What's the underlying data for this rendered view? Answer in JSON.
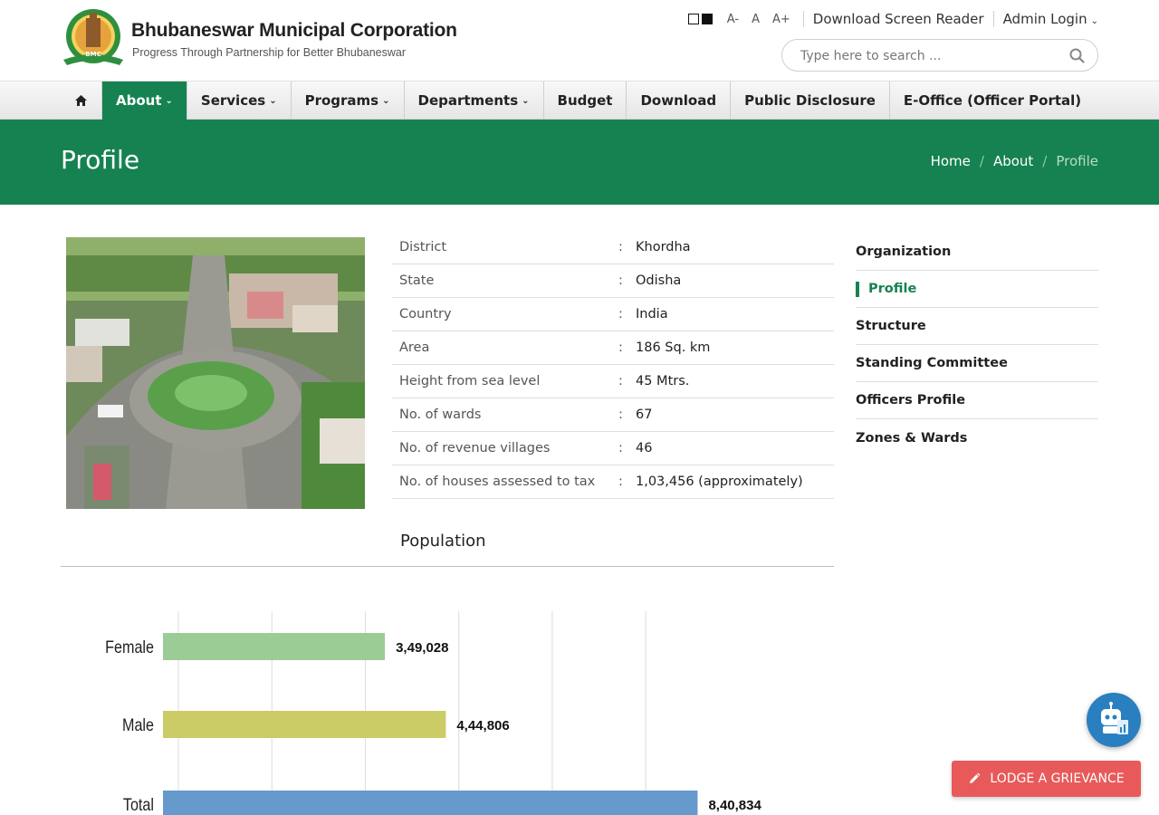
{
  "header": {
    "title": "Bhubaneswar Municipal Corporation",
    "tagline": "Progress Through Partnership for Better Bhubaneswar",
    "logo_text": "BMC",
    "font_sizes": [
      "A-",
      "A",
      "A+"
    ],
    "screen_reader": "Download Screen Reader",
    "admin_login": "Admin Login",
    "search_placeholder": "Type here to search ..."
  },
  "nav": {
    "items": [
      {
        "label": "About",
        "dropdown": true,
        "active": true
      },
      {
        "label": "Services",
        "dropdown": true
      },
      {
        "label": "Programs",
        "dropdown": true
      },
      {
        "label": "Departments",
        "dropdown": true
      },
      {
        "label": "Budget"
      },
      {
        "label": "Download"
      },
      {
        "label": "Public Disclosure"
      },
      {
        "label": "E-Office (Officer Portal)"
      }
    ]
  },
  "banner": {
    "title": "Profile",
    "breadcrumb": [
      "Home",
      "About",
      "Profile"
    ]
  },
  "profile": {
    "rows": [
      {
        "label": "District",
        "value": "Khordha"
      },
      {
        "label": "State",
        "value": "Odisha"
      },
      {
        "label": "Country",
        "value": "India"
      },
      {
        "label": "Area",
        "value": "186 Sq. km"
      },
      {
        "label": "Height from sea level",
        "value": "45 Mtrs."
      },
      {
        "label": "No. of wards",
        "value": "67"
      },
      {
        "label": "No. of revenue villages",
        "value": "46"
      },
      {
        "label": "No. of houses assessed to tax",
        "value": "1,03,456 (approximately)"
      }
    ],
    "separator": ":"
  },
  "population": {
    "title": "Population"
  },
  "chart_data": {
    "type": "bar",
    "orientation": "horizontal",
    "categories": [
      "Female",
      "Male",
      "Total"
    ],
    "values": [
      349028,
      444806,
      840834
    ],
    "value_labels": [
      "3,49,028",
      "4,44,806",
      "8,40,834"
    ],
    "colors": [
      "#9ccc96",
      "#cccc66",
      "#6699cc"
    ],
    "xlim": [
      0,
      900000
    ],
    "grid": true
  },
  "sidebar": {
    "items": [
      {
        "label": "Organization"
      },
      {
        "label": "Profile",
        "active": true
      },
      {
        "label": "Structure"
      },
      {
        "label": "Standing Committee"
      },
      {
        "label": "Officers Profile"
      },
      {
        "label": "Zones & Wards"
      }
    ]
  },
  "floating": {
    "grievance": "LODGE A GRIEVANCE"
  },
  "colors": {
    "primary": "#168251",
    "grievance": "#e85a5a",
    "bot": "#2a7fc0"
  }
}
